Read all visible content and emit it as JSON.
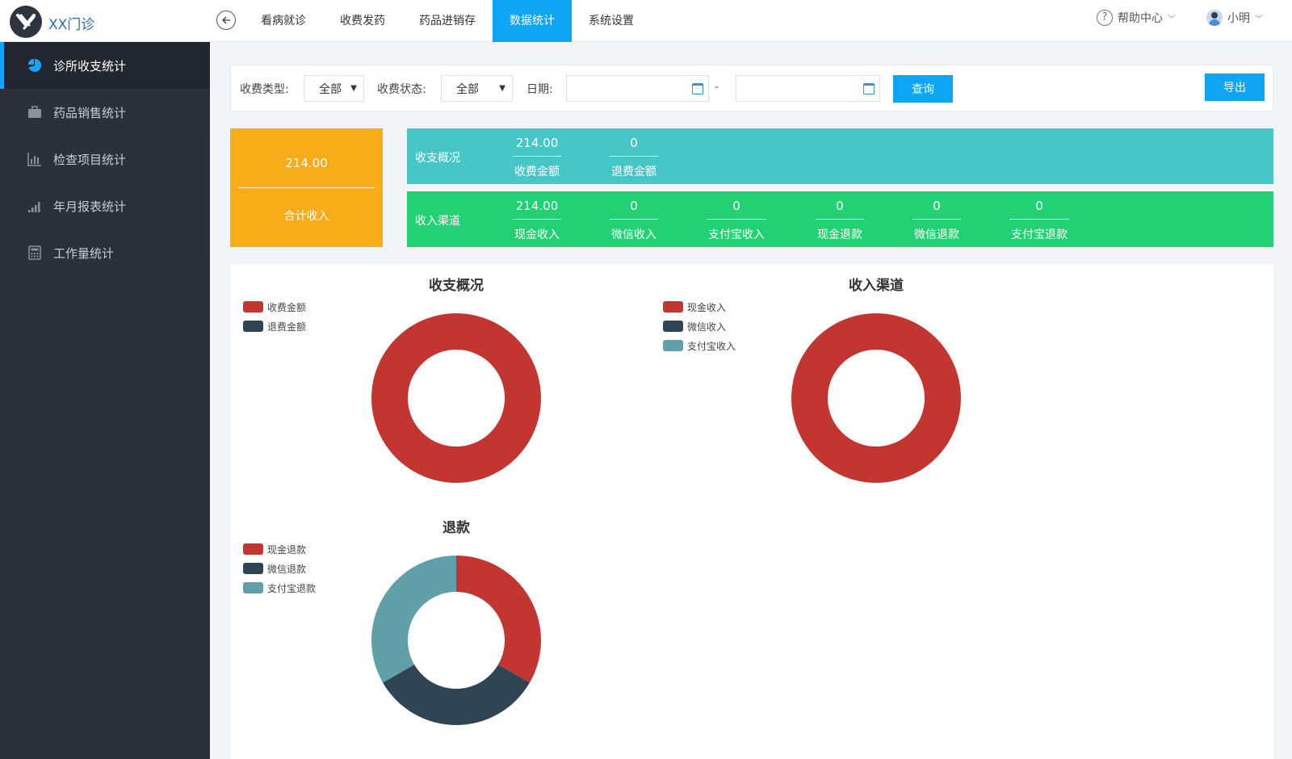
{
  "header": {
    "brand": "XX门诊",
    "nav": [
      {
        "label": "看病就诊",
        "active": false
      },
      {
        "label": "收费发药",
        "active": false
      },
      {
        "label": "药品进销存",
        "active": false
      },
      {
        "label": "数据统计",
        "active": true
      },
      {
        "label": "系统设置",
        "active": false
      }
    ],
    "help": "帮助中心",
    "user": "小明"
  },
  "sidebar": {
    "items": [
      {
        "label": "诊所收支统计",
        "icon": "pie-icon",
        "active": true
      },
      {
        "label": "药品销售统计",
        "icon": "briefcase-icon",
        "active": false
      },
      {
        "label": "检查项目统计",
        "icon": "bar-chart-icon",
        "active": false
      },
      {
        "label": "年月报表统计",
        "icon": "signal-icon",
        "active": false
      },
      {
        "label": "工作量统计",
        "icon": "calculator-icon",
        "active": false
      }
    ]
  },
  "filter": {
    "type_label": "收费类型:",
    "type_value": "全部",
    "status_label": "收费状态:",
    "status_value": "全部",
    "date_label": "日期:",
    "date_start": "",
    "date_end": "",
    "separator": "-",
    "query": "查询",
    "export": "导出"
  },
  "summary": {
    "total_value": "214.00",
    "total_label": "合计收入",
    "overview": {
      "title": "收支概况",
      "cells": [
        {
          "value": "214.00",
          "label": "收费金额"
        },
        {
          "value": "0",
          "label": "退费金额"
        }
      ]
    },
    "channels": {
      "title": "收入渠道",
      "cells": [
        {
          "value": "214.00",
          "label": "现金收入"
        },
        {
          "value": "0",
          "label": "微信收入"
        },
        {
          "value": "0",
          "label": "支付宝收入"
        },
        {
          "value": "0",
          "label": "现金退款"
        },
        {
          "value": "0",
          "label": "微信退款"
        },
        {
          "value": "0",
          "label": "支付宝退款"
        }
      ]
    }
  },
  "colors": {
    "accent": "#0ea5f5",
    "red": "#c23531",
    "navy": "#2f4554",
    "teal": "#61a0a8"
  },
  "chart_data": [
    {
      "type": "pie",
      "title": "收支概况",
      "labels": [
        "收费金额",
        "退费金额"
      ],
      "values": [
        214.0,
        0
      ],
      "colors": [
        "#c23531",
        "#2f4554"
      ]
    },
    {
      "type": "pie",
      "title": "收入渠道",
      "labels": [
        "现金收入",
        "微信收入",
        "支付宝收入"
      ],
      "values": [
        214.0,
        0,
        0
      ],
      "colors": [
        "#c23531",
        "#2f4554",
        "#61a0a8"
      ]
    },
    {
      "type": "pie",
      "title": "退款",
      "labels": [
        "现金退款",
        "微信退款",
        "支付宝退款"
      ],
      "values": [
        1,
        1,
        1
      ],
      "colors": [
        "#c23531",
        "#2f4554",
        "#61a0a8"
      ]
    }
  ]
}
